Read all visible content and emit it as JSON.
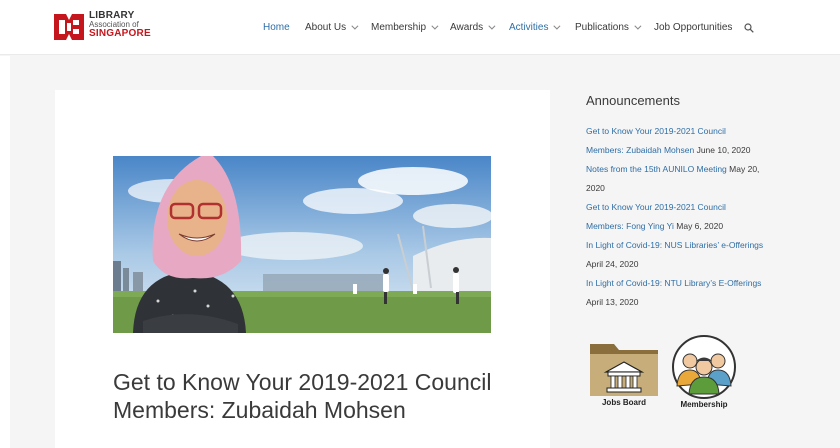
{
  "logo": {
    "line1": "LIBRARY",
    "line2": "Association of",
    "line3": "SINGAPORE"
  },
  "nav": {
    "items": [
      {
        "label": "Home",
        "active": true,
        "dropdown": false
      },
      {
        "label": "About Us",
        "active": false,
        "dropdown": true
      },
      {
        "label": "Membership",
        "active": false,
        "dropdown": true
      },
      {
        "label": "Awards",
        "active": false,
        "dropdown": true
      },
      {
        "label": "Activities",
        "active": true,
        "dropdown": true
      },
      {
        "label": "Publications",
        "active": false,
        "dropdown": true
      },
      {
        "label": "Job Opportunities",
        "active": false,
        "dropdown": false
      }
    ],
    "search_icon": "search-icon"
  },
  "article": {
    "title": "Get to Know Your 2019-2021 Council Members: Zubaidah Mohsen"
  },
  "sidebar": {
    "heading": "Announcements",
    "announcements": [
      {
        "title": "Get to Know Your 2019-2021 Council Members: Zubaidah Mohsen",
        "date": "June 10, 2020"
      },
      {
        "title": "Notes from the 15th AUNILO Meeting",
        "date": "May 20, 2020"
      },
      {
        "title": "Get to Know Your 2019-2021 Council Members: Fong Ying Yi",
        "date": "May 6, 2020"
      },
      {
        "title": "In Light of Covid-19: NUS Libraries’ e-Offerings",
        "date": "April 24, 2020"
      },
      {
        "title": "In Light of Covid-19: NTU Library’s E-Offerings",
        "date": "April 13, 2020"
      }
    ],
    "widgets": [
      {
        "label": "Jobs Board",
        "icon": "folder-building-icon"
      },
      {
        "label": "Membership",
        "icon": "group-people-icon"
      }
    ]
  },
  "colors": {
    "link": "#2e6ea6",
    "brand_red": "#c4161c",
    "text": "#3a3a3a",
    "background": "#f5f5f5"
  }
}
